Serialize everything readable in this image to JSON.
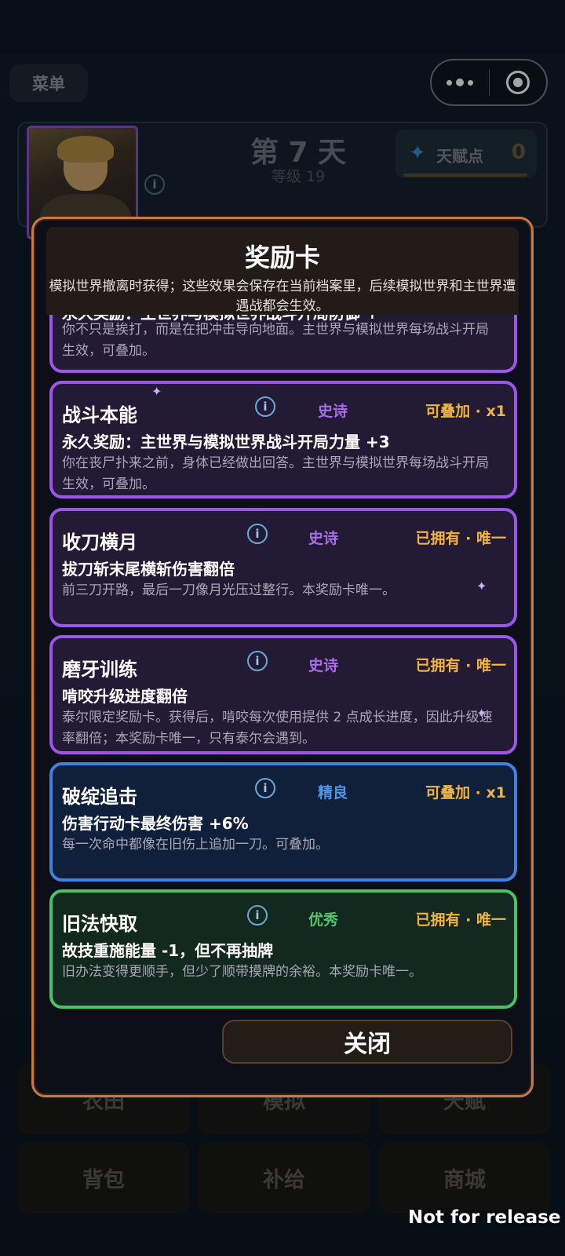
{
  "menu": {
    "label": "菜单"
  },
  "header": {
    "day_title": "第 7 天",
    "level": "等级 19",
    "talent_label": "天赋点",
    "talent_value": "0",
    "info_glyph": "i"
  },
  "modal": {
    "title": "奖励卡",
    "description": "模拟世界撤离时获得；这些效果会保存在当前档案里，后续模拟世界和主世界遭遇战都会生效。",
    "close_label": "关闭",
    "cards": [
      {
        "name": "",
        "rarity": "",
        "status": "",
        "effect": "永久奖励：主世界与模拟世界战斗开局防御 +",
        "text": "你不只是挨打，而是在把冲击导向地面。主世界与模拟世界每场战斗开局生效，可叠加。",
        "tier": "epic"
      },
      {
        "name": "战斗本能",
        "rarity": "史诗",
        "status": "可叠加 · x1",
        "effect": "永久奖励：主世界与模拟世界战斗开局力量 +3",
        "text": "你在丧尸扑来之前，身体已经做出回答。主世界与模拟世界每场战斗开局生效，可叠加。",
        "tier": "epic"
      },
      {
        "name": "收刀横月",
        "rarity": "史诗",
        "status": "已拥有 · 唯一",
        "effect": "拔刀斩末尾横斩伤害翻倍",
        "text": "前三刀开路，最后一刀像月光压过整行。本奖励卡唯一。",
        "tier": "epic"
      },
      {
        "name": "磨牙训练",
        "rarity": "史诗",
        "status": "已拥有 · 唯一",
        "effect": "啃咬升级进度翻倍",
        "text": "泰尔限定奖励卡。获得后，啃咬每次使用提供 2 点成长进度，因此升级速率翻倍；本奖励卡唯一，只有泰尔会遇到。",
        "tier": "epic"
      },
      {
        "name": "破绽追击",
        "rarity": "精良",
        "status": "可叠加 · x1",
        "effect": "伤害行动卡最终伤害 +6%",
        "text": "每一次命中都像在旧伤上追加一刀。可叠加。",
        "tier": "fine"
      },
      {
        "name": "旧法快取",
        "rarity": "优秀",
        "status": "已拥有 · 唯一",
        "effect": "故技重施能量 -1，但不再抽牌",
        "text": "旧办法变得更顺手，但少了顺带摸牌的余裕。本奖励卡唯一。",
        "tier": "good"
      }
    ]
  },
  "bottom_nav": {
    "row1": [
      "农田",
      "模拟",
      "天赋"
    ],
    "row2": [
      "背包",
      "补给",
      "商城"
    ]
  },
  "watermark": "Not for release",
  "icons": {
    "talent": "crystal-star-icon",
    "more": "more-dots-icon",
    "target": "target-icon",
    "sparkle": "sparkle-icon"
  },
  "colors": {
    "epic": "#9e55ea",
    "fine": "#3e82dd",
    "good": "#48c262",
    "status": "#f1b43c",
    "modal_border": "#c67a48"
  }
}
